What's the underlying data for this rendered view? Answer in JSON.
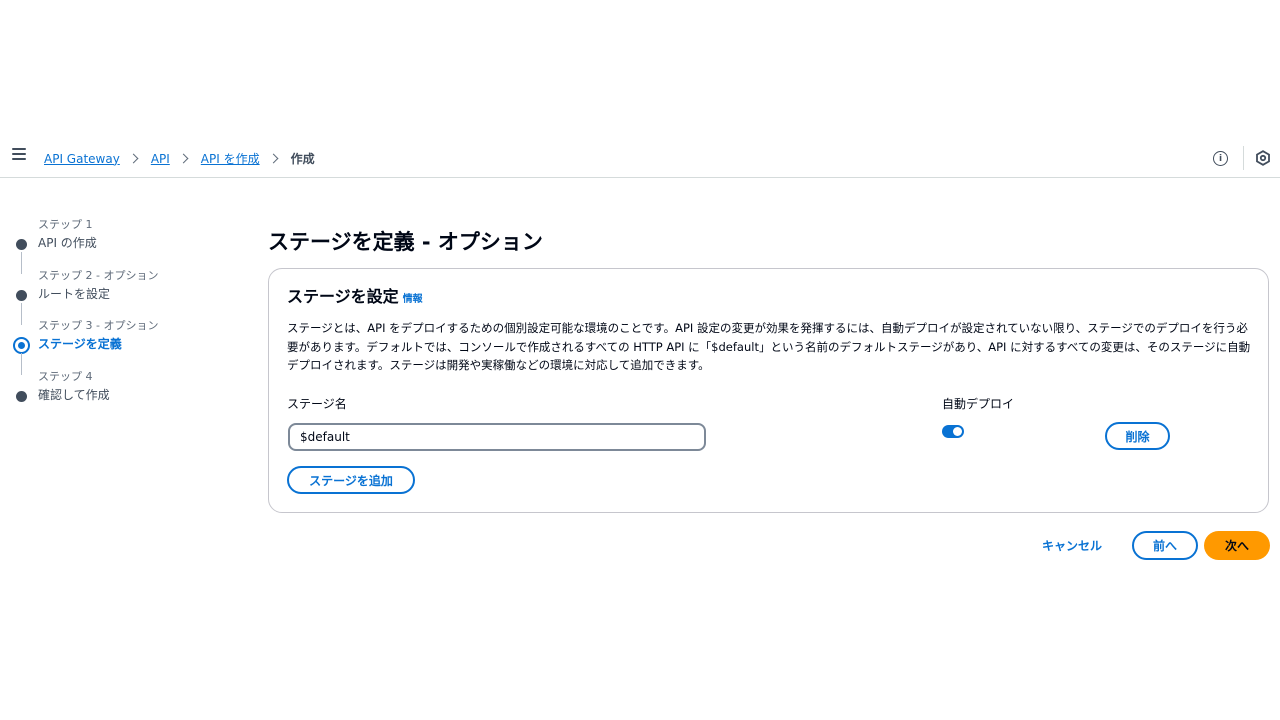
{
  "breadcrumb": {
    "items": [
      "API Gateway",
      "API",
      "API を作成"
    ],
    "current": "作成"
  },
  "header": {
    "info_icon_glyph": "i"
  },
  "steps": [
    {
      "num": "ステップ 1",
      "title": "API の作成",
      "active": false
    },
    {
      "num": "ステップ 2 - オプション",
      "title": "ルートを設定",
      "active": false
    },
    {
      "num": "ステップ 3 - オプション",
      "title": "ステージを定義",
      "active": true
    },
    {
      "num": "ステップ 4",
      "title": "確認して作成",
      "active": false
    }
  ],
  "page": {
    "title": "ステージを定義 - オプション"
  },
  "panel": {
    "title": "ステージを設定",
    "info_link": "情報",
    "description": "ステージとは、API をデプロイするための個別設定可能な環境のことです。API 設定の変更が効果を発揮するには、自動デプロイが設定されていない限り、ステージでのデプロイを行う必要があります。デフォルトでは、コンソールで作成されるすべての HTTP API に「$default」という名前のデフォルトステージがあり、API に対するすべての変更は、そのステージに自動デプロイされます。ステージは開発や実稼働などの環境に対応して追加できます。",
    "stage_name_label": "ステージ名",
    "stage_name_value": "$default",
    "auto_deploy_label": "自動デプロイ",
    "auto_deploy_enabled": true,
    "delete_label": "削除",
    "add_stage_label": "ステージを追加"
  },
  "footer": {
    "cancel_label": "キャンセル",
    "prev_label": "前へ",
    "next_label": "次へ"
  },
  "colors": {
    "link": "#0972d3",
    "primary_button": "#ff9900",
    "text": "#000716"
  },
  "icons": {
    "menu": "hamburger-menu-icon",
    "info": "info-icon",
    "settings": "settings-icon"
  }
}
